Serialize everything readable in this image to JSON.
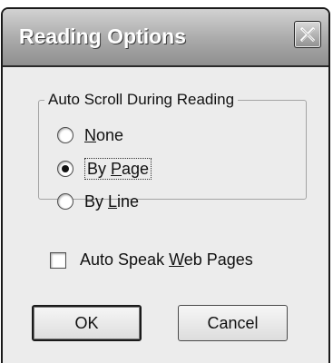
{
  "window": {
    "title": "Reading Options",
    "close_icon": "close-icon"
  },
  "auto_scroll": {
    "label": "Auto Scroll During Reading",
    "options": [
      {
        "pre": "",
        "key": "N",
        "post": "one",
        "checked": false
      },
      {
        "pre": "By ",
        "key": "P",
        "post": "age",
        "checked": true
      },
      {
        "pre": "By ",
        "key": "L",
        "post": "ine",
        "checked": false
      }
    ]
  },
  "auto_speak": {
    "pre": "Auto Speak ",
    "key": "W",
    "post": "eb Pages",
    "checked": false
  },
  "buttons": {
    "ok": "OK",
    "cancel": "Cancel"
  }
}
